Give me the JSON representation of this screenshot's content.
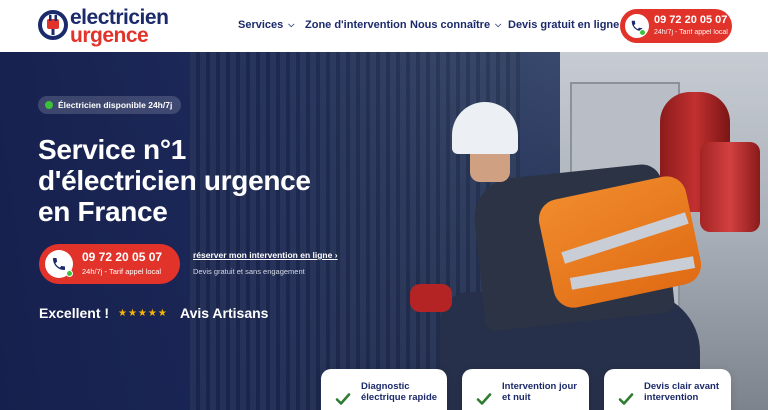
{
  "brand": {
    "line1": "electricien",
    "line2": "urgence"
  },
  "nav": {
    "services": "Services",
    "zone": "Zone d'intervention",
    "about": "Nous connaître",
    "quote": "Devis gratuit en ligne"
  },
  "header_phone": {
    "number": "09 72 20 05 07",
    "note": "24h/7j - Tarif appel local"
  },
  "hero": {
    "availability": "Électricien disponible 24h/7j",
    "title_line1": "Service n°1",
    "title_line2": "d'électricien urgence",
    "title_line3": "en France",
    "cta_phone": {
      "number": "09 72 20 05 07",
      "note": "24h/7j - Tarif appel local"
    },
    "reserve_link": "réserver mon intervention en ligne",
    "reserve_note": "Devis gratuit et sans engagement",
    "rating_label": "Excellent !",
    "stars": "★★★★★",
    "rating_source": "Avis Artisans"
  },
  "features": [
    {
      "label": "Diagnostic électrique rapide"
    },
    {
      "label": "Intervention jour et nuit"
    },
    {
      "label": "Devis clair avant intervention"
    }
  ],
  "colors": {
    "brand_blue": "#1b2a6b",
    "brand_red": "#e2332b",
    "available_green": "#3cc13b",
    "star_gold": "#f6b400"
  }
}
